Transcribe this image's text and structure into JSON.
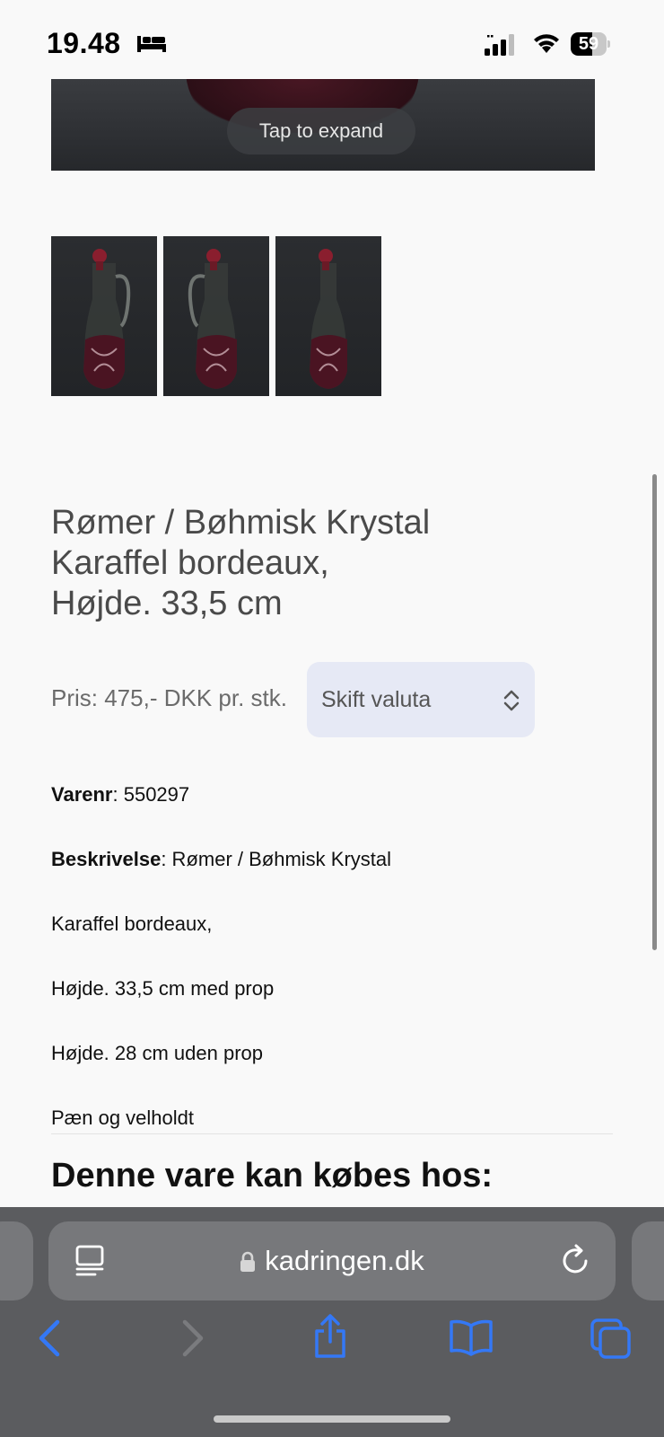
{
  "status_bar": {
    "time": "19.48",
    "battery_level": 59,
    "battery_label": "59"
  },
  "hero": {
    "expand_label": "Tap to expand"
  },
  "product": {
    "title_line1": "Rømer / Bøhmisk Krystal",
    "title_line2": "Karaffel bordeaux,",
    "title_line3": "Højde. 33,5 cm",
    "price": "Pris: 475,- DKK pr. stk.",
    "currency_select": "Skift valuta",
    "item_number_label": "Varenr",
    "item_number_value": ": 550297",
    "description_label": "Beskrivelse",
    "description_value": ": Rømer / Bøhmisk Krystal",
    "desc_line2": "Karaffel bordeaux,",
    "desc_line3": "Højde. 33,5 cm med prop",
    "desc_line4": "Højde. 28 cm uden prop",
    "desc_line5": "Pæn og velholdt",
    "buy_heading": "Denne vare kan købes hos:"
  },
  "browser": {
    "url": "kadringen.dk"
  },
  "colors": {
    "accent": "#3478f6",
    "toolbar": "#5b5c5f",
    "select_bg": "#e6e9f5",
    "glass": "#5a1424"
  },
  "icons": [
    "bed-icon",
    "signal-icon",
    "wifi-icon",
    "battery-icon",
    "reader-icon",
    "lock-icon",
    "reload-icon",
    "back-icon",
    "forward-icon",
    "share-icon",
    "bookmarks-icon",
    "tabs-icon",
    "chevron-updown-icon"
  ]
}
